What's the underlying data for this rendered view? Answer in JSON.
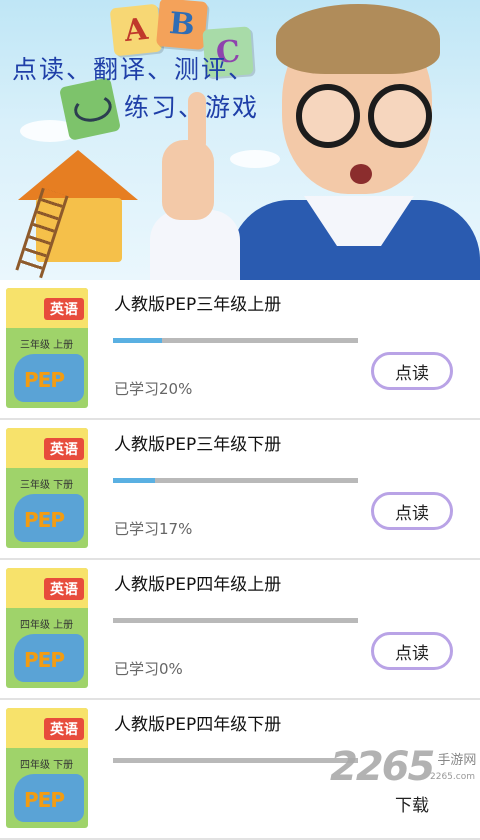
{
  "banner": {
    "slogan_line1": "点读、翻译、测评、",
    "slogan_line2": "练习、游戏",
    "blocks": [
      "A",
      "B",
      "C"
    ]
  },
  "books": [
    {
      "title": "人教版PEP三年级上册",
      "status": "已学习20%",
      "progress": 0.2,
      "button": "点读",
      "cover_grade": "三年级 上册"
    },
    {
      "title": "人教版PEP三年级下册",
      "status": "已学习17%",
      "progress": 0.17,
      "button": "点读",
      "cover_grade": "三年级 下册"
    },
    {
      "title": "人教版PEP四年级上册",
      "status": "已学习0%",
      "progress": 0.0,
      "button": "点读",
      "cover_grade": "四年级 上册"
    },
    {
      "title": "人教版PEP四年级下册",
      "status": "",
      "progress": 0.0,
      "button": "下载",
      "cover_grade": "四年级 下册"
    }
  ],
  "cover": {
    "logo": "英语",
    "pep": "PEP"
  },
  "watermark": {
    "number": "2265",
    "suffix": "手游网",
    "url": "2265.com"
  },
  "colors": {
    "accent": "#5ab0e2",
    "button_border": "#b9a3e6",
    "slogan": "#1f3fa8"
  }
}
